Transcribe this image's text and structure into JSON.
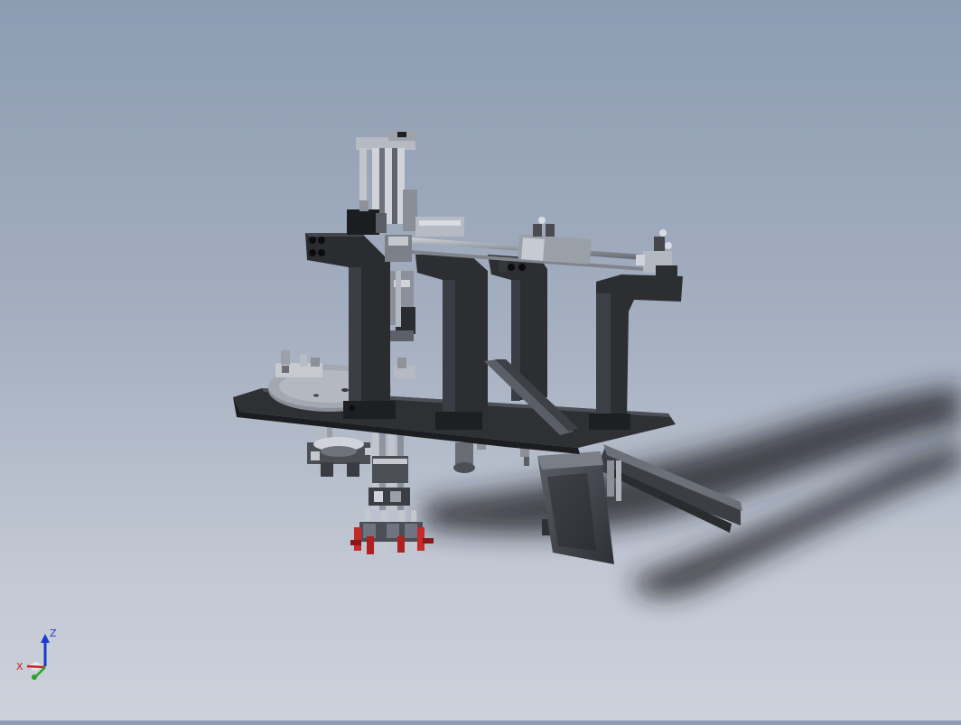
{
  "viewport": {
    "background_top": "#8d9cb2",
    "background_bottom": "#ccd1da",
    "model_color": "#2e3034",
    "shadow_color": "#1c1e22"
  },
  "triad": {
    "z_label": "Z",
    "x_label": "X",
    "z_color": "#1a3ccc",
    "x_color": "#c81e1e",
    "y_color": "#2aa12a"
  }
}
